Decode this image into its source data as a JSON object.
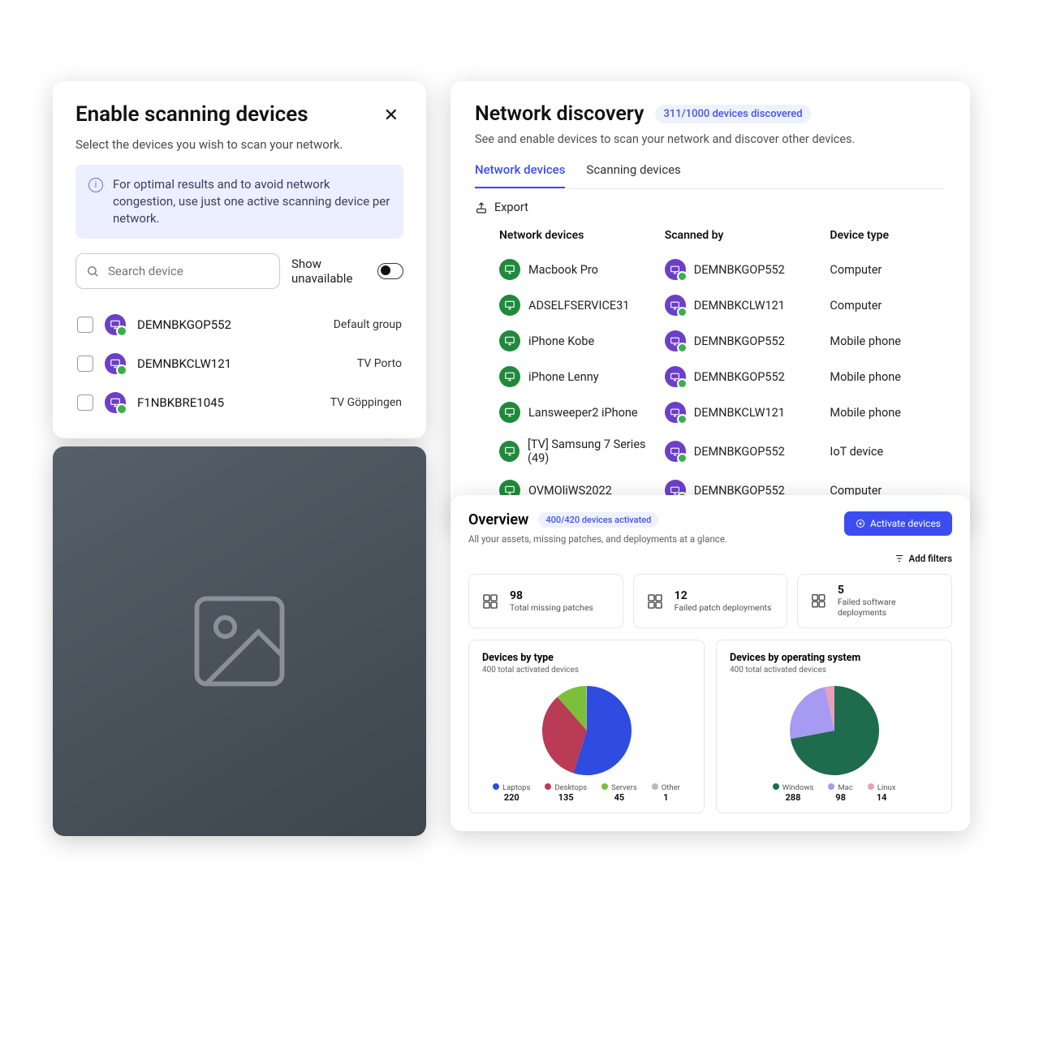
{
  "panelA": {
    "title": "Enable scanning devices",
    "subtitle": "Select the devices you wish to scan your network.",
    "info": "For optimal results and to avoid network congestion, use just one active scanning device per network.",
    "search_placeholder": "Search device",
    "show_unavailable_label": "Show unavailable",
    "devices": [
      {
        "name": "DEMNBKGOP552",
        "group": "Default group"
      },
      {
        "name": "DEMNBKCLW121",
        "group": "TV Porto"
      },
      {
        "name": "F1NBKBRE1045",
        "group": "TV Göppingen"
      }
    ]
  },
  "panelB": {
    "title": "Network discovery",
    "badge": "311/1000 devices discovered",
    "subtitle": "See and enable devices to scan your network and discover other devices.",
    "tabs": {
      "network": "Network devices",
      "scanning": "Scanning devices"
    },
    "export_label": "Export",
    "columns": {
      "c1": "Network devices",
      "c2": "Scanned by",
      "c3": "Device type"
    },
    "rows": [
      {
        "device": "Macbook Pro",
        "scanner": "DEMNBKGOP552",
        "type": "Computer"
      },
      {
        "device": "ADSELFSERVICE31",
        "scanner": "DEMNBKCLW121",
        "type": "Computer"
      },
      {
        "device": "iPhone Kobe",
        "scanner": "DEMNBKGOP552",
        "type": "Mobile phone"
      },
      {
        "device": "iPhone Lenny",
        "scanner": "DEMNBKGOP552",
        "type": "Mobile phone"
      },
      {
        "device": "Lansweeper2 iPhone",
        "scanner": "DEMNBKCLW121",
        "type": "Mobile phone"
      },
      {
        "device": "[TV] Samsung 7 Series (49)",
        "scanner": "DEMNBKGOP552",
        "type": "IoT device"
      },
      {
        "device": "OVMOliWS2022",
        "scanner": "DEMNBKGOP552",
        "type": "Computer"
      }
    ]
  },
  "panelC": {
    "title": "Overview",
    "badge": "400/420 devices activated",
    "activate_btn": "Activate devices",
    "subtitle": "All your assets, missing patches, and deployments at a glance.",
    "add_filters": "Add filters",
    "stats": [
      {
        "num": "98",
        "label": "Total missing patches"
      },
      {
        "num": "12",
        "label": "Failed patch deployments"
      },
      {
        "num": "5",
        "label": "Failed software deployments"
      }
    ],
    "chart1": {
      "title": "Devices by type",
      "subtitle": "400 total activated devices"
    },
    "chart2": {
      "title": "Devices by operating system",
      "subtitle": "400 total activated devices"
    }
  },
  "chart_data": [
    {
      "type": "pie",
      "title": "Devices by type",
      "subtitle": "400 total activated devices",
      "series": [
        {
          "name": "Laptops",
          "value": 220,
          "color": "#2f4be0"
        },
        {
          "name": "Desktops",
          "value": 135,
          "color": "#b93b55"
        },
        {
          "name": "Servers",
          "value": 45,
          "color": "#7bbf3a"
        },
        {
          "name": "Other",
          "value": 1,
          "color": "#b9b9c2"
        }
      ]
    },
    {
      "type": "pie",
      "title": "Devices by operating system",
      "subtitle": "400 total activated devices",
      "series": [
        {
          "name": "Windows",
          "value": 288,
          "color": "#1f6b4d"
        },
        {
          "name": "Mac",
          "value": 98,
          "color": "#a79af2"
        },
        {
          "name": "Linux",
          "value": 14,
          "color": "#e8a0ba"
        }
      ]
    }
  ]
}
